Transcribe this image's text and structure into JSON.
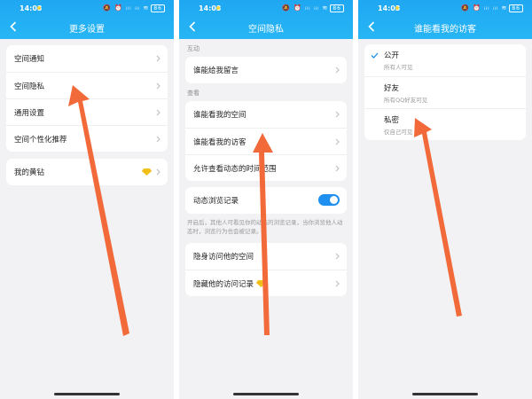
{
  "status_bar": {
    "time": "14:03",
    "icons": "🔕 ⏰ ᵢₗₗ ᵢₗₗ ≋",
    "battery": "86"
  },
  "screen1": {
    "title": "更多设置",
    "group1": [
      "空间通知",
      "空间隐私",
      "通用设置",
      "空间个性化推荐"
    ],
    "group2": {
      "label": "我的黄钻",
      "icon": "yellow-diamond-icon"
    }
  },
  "screen2": {
    "title": "空间隐私",
    "section_interact": "互动",
    "item_comment": "谁能给我留言",
    "section_view": "查看",
    "view_items": [
      "谁能看我的空间",
      "谁能看我的访客",
      "允许查看动态的时间范围"
    ],
    "feed_record": "动态浏览记录",
    "feed_record_on": true,
    "feed_desc": "开启后，其他人可看见你的动态的浏览记录，当你浏览他人动态时，浏览行为也会被记录。",
    "stealth_items": [
      "隐身访问他的空间",
      "隐藏他的访问记录"
    ]
  },
  "screen3": {
    "title": "谁能看我的访客",
    "options": [
      {
        "label": "公开",
        "desc": "所有人可见",
        "selected": true
      },
      {
        "label": "好友",
        "desc": "所有QQ好友可见",
        "selected": false
      },
      {
        "label": "私密",
        "desc": "仅自己可见",
        "selected": false
      }
    ]
  },
  "colors": {
    "header": "#1fa7f2",
    "arrow": "#f26a3a",
    "accent": "#1f8ff0",
    "gem": "#f4c21c"
  }
}
